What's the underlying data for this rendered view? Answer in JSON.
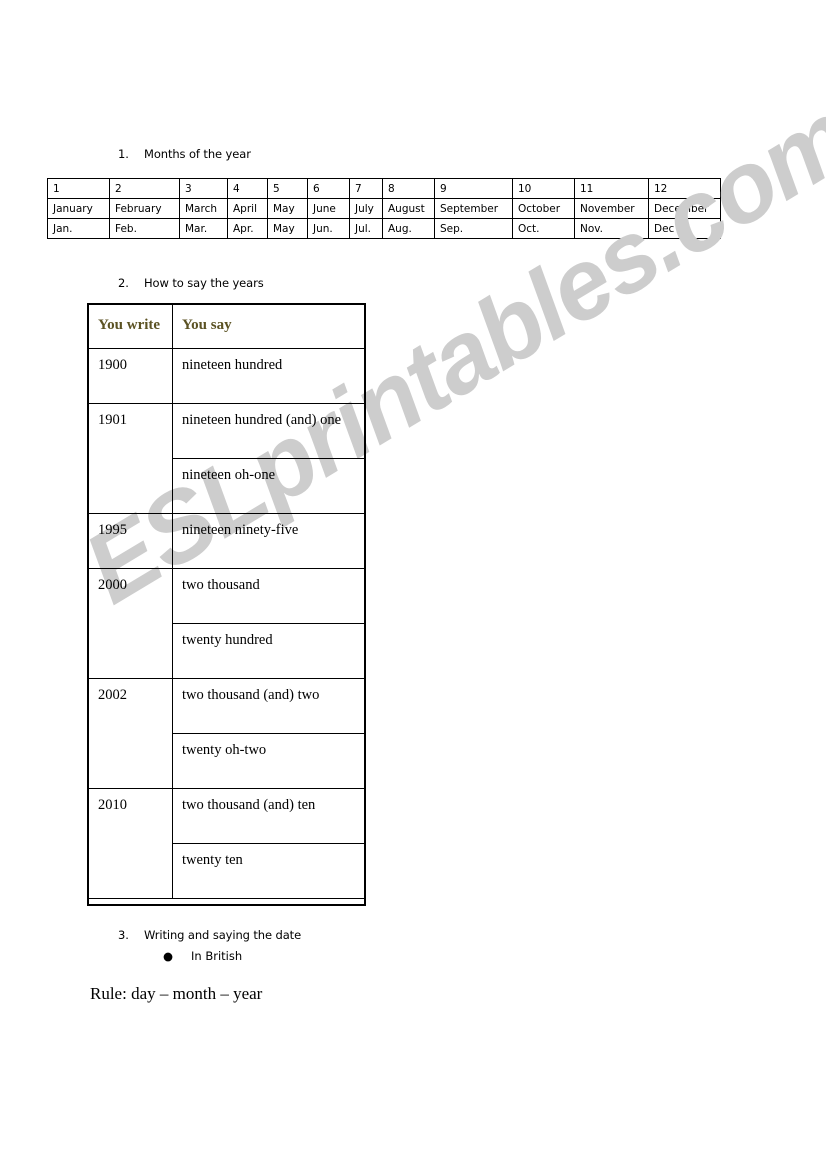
{
  "document": {
    "watermark_text": "ESLprintables.com",
    "watermark_color": "#cdcdcd"
  },
  "section1": {
    "number": "1.",
    "title": "Months of the year",
    "table": {
      "rows": [
        [
          "1",
          "2",
          "3",
          "4",
          "5",
          "6",
          "7",
          "8",
          "9",
          "10",
          "11",
          "12"
        ],
        [
          "January",
          "February",
          "March",
          "April",
          "May",
          "June",
          "July",
          "August",
          "September",
          "October",
          "November",
          "December"
        ],
        [
          "Jan.",
          "Feb.",
          "Mar.",
          "Apr.",
          "May",
          "Jun.",
          "Jul.",
          "Aug.",
          "Sep.",
          "Oct.",
          "Nov.",
          "Dec"
        ]
      ]
    }
  },
  "section2": {
    "number": "2.",
    "title": "How to say the years",
    "header_color": "#5b5223",
    "table": {
      "headers": [
        "You write",
        "You say"
      ],
      "rows": [
        {
          "year": "1900",
          "says": [
            "nineteen hundred"
          ]
        },
        {
          "year": "1901",
          "says": [
            "nineteen hundred (and) one",
            "nineteen oh-one"
          ]
        },
        {
          "year": "1995",
          "says": [
            "nineteen ninety-five"
          ]
        },
        {
          "year": "2000",
          "says": [
            "two thousand",
            "twenty hundred"
          ]
        },
        {
          "year": "2002",
          "says": [
            "two thousand (and) two",
            "twenty oh-two"
          ]
        },
        {
          "year": "2010",
          "says": [
            "two thousand (and) ten",
            "twenty ten"
          ]
        }
      ]
    }
  },
  "section3": {
    "number": "3.",
    "title": "Writing and saying the date",
    "bullet_glyph": "●",
    "bullet_text": "In British",
    "rule_text": "Rule: day – month – year"
  }
}
